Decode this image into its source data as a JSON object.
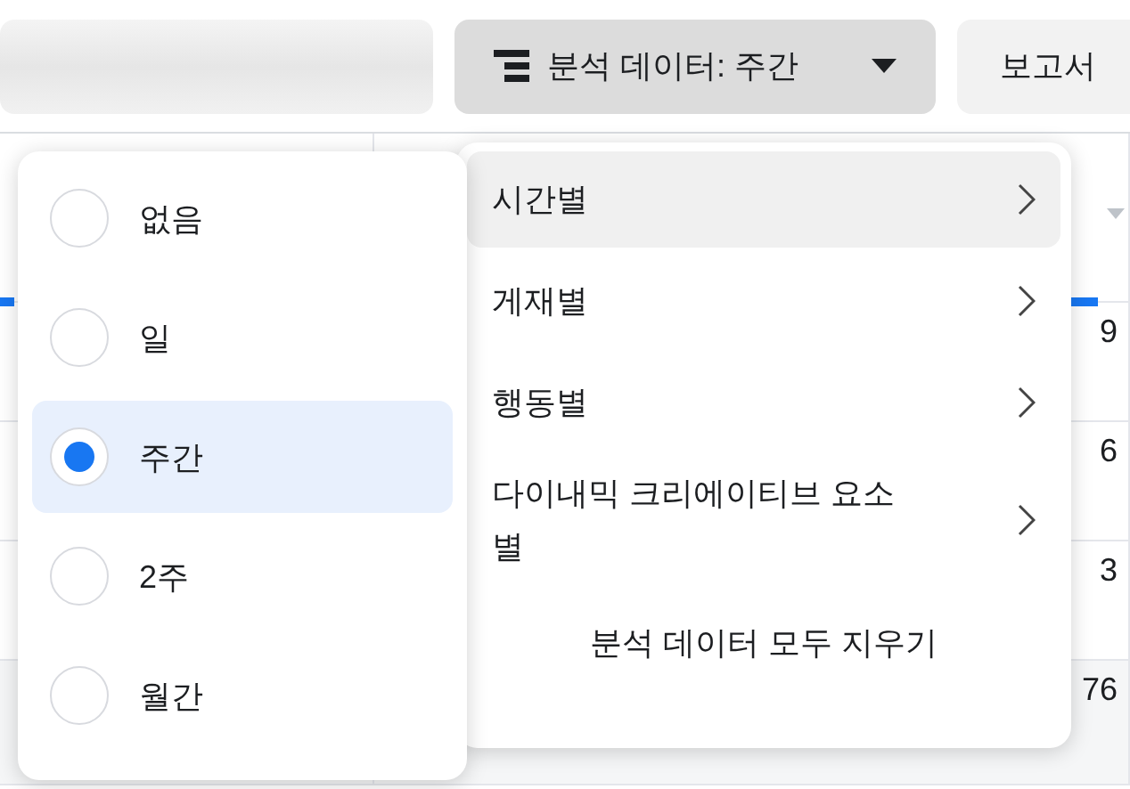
{
  "toolbar": {
    "breakdown_button": {
      "label": "분석 데이터: 주간"
    },
    "report_button": {
      "label": "보고서"
    }
  },
  "table": {
    "rows": [
      {
        "column_3": "9"
      },
      {
        "column_3": "6"
      },
      {
        "column_3": "3"
      },
      {
        "column_3": "76"
      }
    ]
  },
  "period_menu": {
    "options": [
      {
        "label": "없음",
        "selected": false
      },
      {
        "label": "일",
        "selected": false
      },
      {
        "label": "주간",
        "selected": true
      },
      {
        "label": "2주",
        "selected": false
      },
      {
        "label": "월간",
        "selected": false
      }
    ]
  },
  "breakdown_menu": {
    "items": [
      {
        "label": "시간별",
        "highlighted": true
      },
      {
        "label": "게재별",
        "highlighted": false
      },
      {
        "label": "행동별",
        "highlighted": false
      },
      {
        "label": "다이내믹 크리에이티브 요소별",
        "highlighted": false
      }
    ],
    "clear_button": {
      "label": "분석 데이터 모두 지우기"
    }
  }
}
